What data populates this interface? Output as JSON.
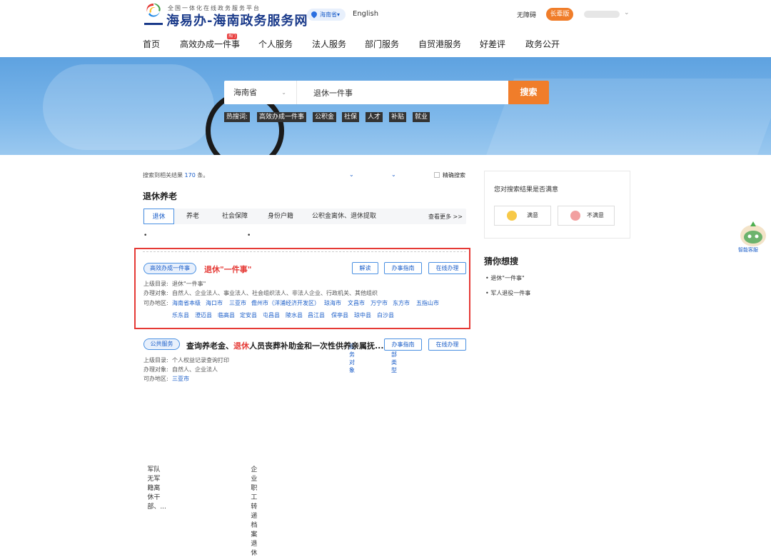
{
  "header": {
    "logo_small": "全国一体化在线政务服务平台",
    "logo_big": "海易办-海南政务服务网",
    "region": "海南省",
    "language": "English",
    "accessibility": "无障碍",
    "elder_mode": "长辈版"
  },
  "nav": {
    "items": [
      "首页",
      "高效办成一件事",
      "个人服务",
      "法人服务",
      "部门服务",
      "自贸港服务",
      "好差评",
      "政务公开"
    ],
    "hot_badge": "热门"
  },
  "search": {
    "region": "海南省",
    "query": "退休一件事",
    "button": "搜索",
    "hot_label": "热搜词:",
    "hot_words": [
      "高效办成一件事",
      "公积金",
      "社保",
      "人才",
      "补贴",
      "就业"
    ]
  },
  "results": {
    "count_prefix": "搜索到相关结果",
    "count": "170",
    "count_suffix": "条。",
    "filter_service_object": "服务对象",
    "filter_all_types": "全部类型",
    "exact_search": "精确搜索",
    "category_title": "退休养老",
    "tabs": [
      "退休",
      "养老",
      "社会保障",
      "身份户籍",
      "公积金离休、退休提取"
    ],
    "more": "查看更多 >>",
    "bullets": [
      "军队无军籍离休干部、...",
      "企业职工转递档案退休"
    ]
  },
  "item1": {
    "tag": "高效办成一件事",
    "title": "退休\"一件事\"",
    "btn_interpret": "解读",
    "btn_guide": "办事指南",
    "btn_online": "在线办理",
    "parent_label": "上级目录:",
    "parent_value": "退休\"一件事\"",
    "target_label": "办理对象:",
    "target_value": "自然人、企业法人、事业法人、社会组织法人、非法人企业、行政机关、其他组织",
    "area_label": "可办地区:",
    "areas_row1": [
      "海南省本级",
      "海口市",
      "三亚市",
      "儋州市（洋浦经济开发区）",
      "琼海市",
      "文昌市",
      "万宁市",
      "东方市",
      "五指山市"
    ],
    "areas_row2": [
      "乐东县",
      "澄迈县",
      "临高县",
      "定安县",
      "屯昌县",
      "陵水县",
      "昌江县",
      "保亭县",
      "琼中县",
      "白沙县"
    ]
  },
  "item2": {
    "tag": "公共服务",
    "title_pre": "查询养老金、",
    "title_hl": "退休",
    "title_post": "人员丧葬补助金和一次性供养亲属抚...",
    "btn_guide": "办事指南",
    "btn_online": "在线办理",
    "parent_label": "上级目录:",
    "parent_value": "个人权益记录查询打印",
    "target_label": "办理对象:",
    "target_value": "自然人、企业法人",
    "area_label": "可办地区:",
    "area_value": "三亚市"
  },
  "survey": {
    "question": "您对搜索结果是否满意",
    "satisfied": "满意",
    "unsatisfied": "不满意"
  },
  "guess": {
    "title": "猜你想搜",
    "items": [
      "退休\"一件事\"",
      "军人退役一件事"
    ]
  },
  "assistant": {
    "label": "智能客服"
  }
}
